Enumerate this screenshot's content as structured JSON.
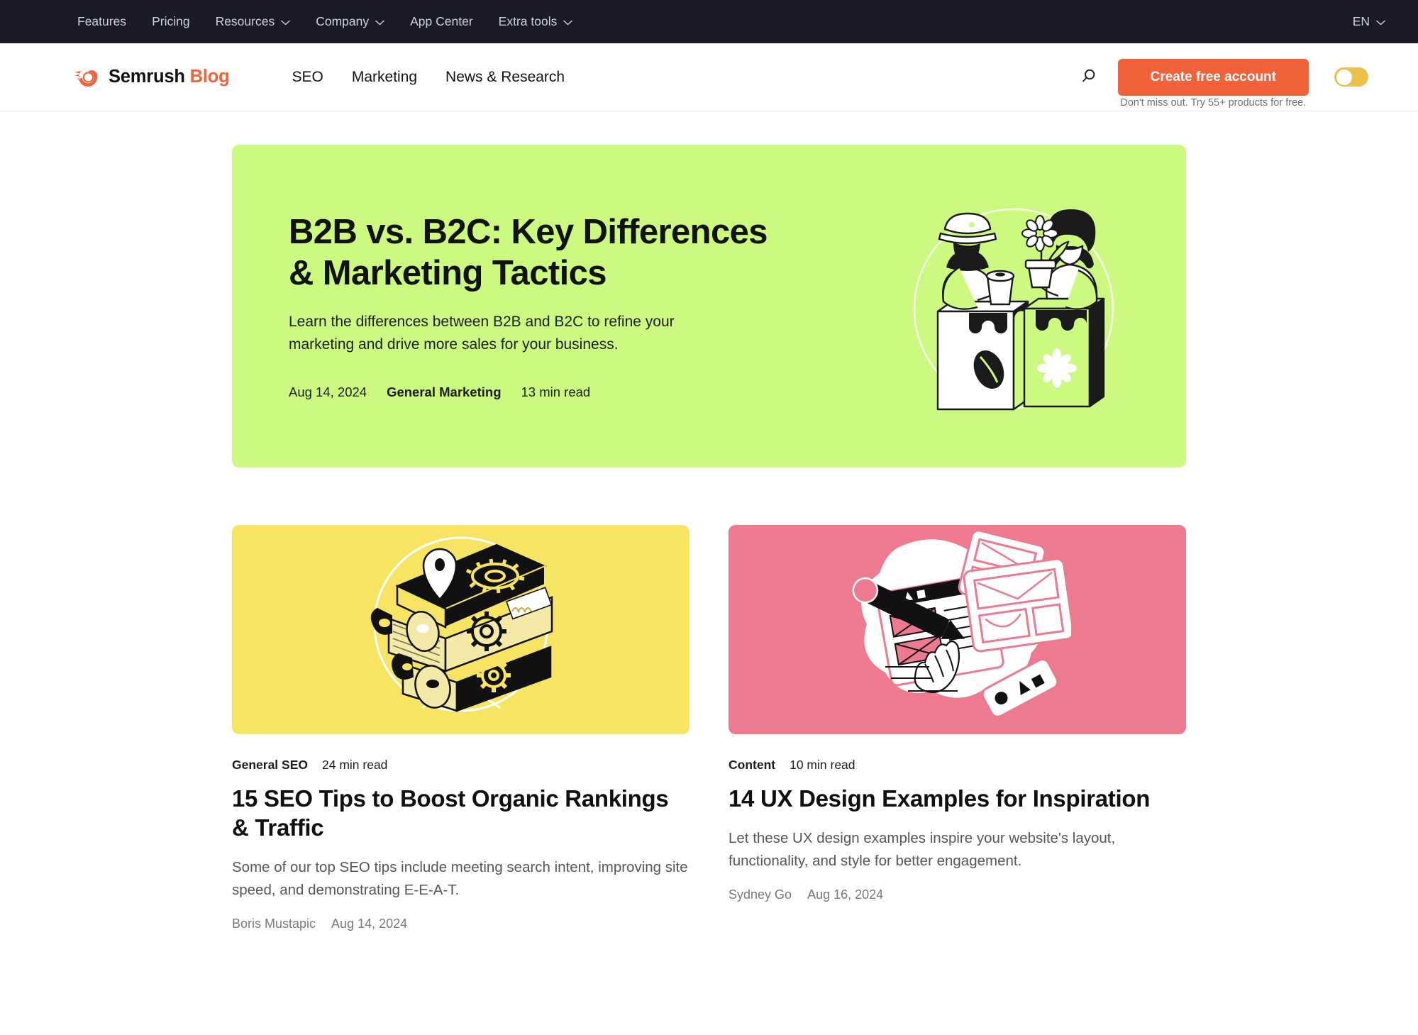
{
  "topbar": {
    "items": [
      {
        "label": "Features",
        "has_chevron": false,
        "icon": ""
      },
      {
        "label": "Pricing",
        "has_chevron": false,
        "icon": ""
      },
      {
        "label": "Resources",
        "has_chevron": true,
        "icon": "chevron-down-icon"
      },
      {
        "label": "Company",
        "has_chevron": true,
        "icon": "chevron-down-icon"
      },
      {
        "label": "App Center",
        "has_chevron": false,
        "icon": ""
      },
      {
        "label": "Extra tools",
        "has_chevron": true,
        "icon": "chevron-down-icon"
      }
    ],
    "language": "EN",
    "language_icon": "chevron-down-icon",
    "background": "#1A1A26"
  },
  "header": {
    "brand_name": "Semrush",
    "brand_suffix": "Blog",
    "brand_icon": "semrush-comet-logo-icon",
    "brand_accent": "#F16437",
    "nav": [
      {
        "label": "SEO"
      },
      {
        "label": "Marketing"
      },
      {
        "label": "News & Research"
      }
    ],
    "search_icon": "search-icon",
    "cta_label": "Create free account",
    "cta_color": "#F1623A",
    "cta_note": "Don't miss out. Try 55+ products for free.",
    "toggle_icon": "dark-mode-toggle",
    "toggle_state": "off",
    "toggle_color": "#EBC04B"
  },
  "hero": {
    "title": "B2B vs. B2C: Key Differences & Marketing Tactics",
    "description": "Learn the differences between B2B and B2C to refine your marketing and drive more sales for your business.",
    "date": "Aug 14, 2024",
    "category": "General Marketing",
    "read_time": "13 min read",
    "background": "#CCFA80",
    "illustration": "market-stall-vendors-illustration"
  },
  "cards": [
    {
      "category": "General SEO",
      "read_time": "24 min read",
      "title": "15 SEO Tips to Boost Organic Rankings & Traffic",
      "description": "Some of our top SEO tips include meeting search intent, improving site speed, and demonstrating E-E-A-T.",
      "author": "Boris Mustapic",
      "date": "Aug 14, 2024",
      "thumb_background": "#F7E463",
      "illustration": "stacked-binders-gears-illustration"
    },
    {
      "category": "Content",
      "read_time": "10 min read",
      "title": "14 UX Design Examples for Inspiration",
      "description": "Let these UX design examples inspire your website's layout, functionality, and style for better engagement.",
      "author": "Sydney Go",
      "date": "Aug 16, 2024",
      "thumb_background": "#EE7A90",
      "illustration": "ux-wireframe-sketching-illustration"
    }
  ]
}
